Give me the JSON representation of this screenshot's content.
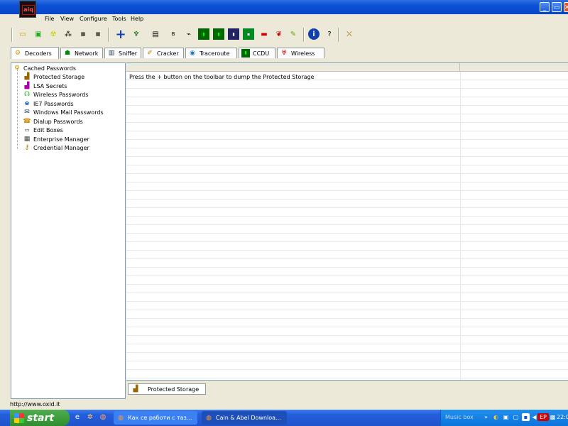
{
  "window": {
    "app_icon_text": "aiq",
    "controls": {
      "minimize": "_",
      "maximize": "▭",
      "close": "✕"
    }
  },
  "menu": [
    "File",
    "View",
    "Configure",
    "Tools",
    "Help"
  ],
  "toolbar_icons": [
    "folder-open-icon",
    "sniffer-start-icon",
    "radioactive-icon",
    "arp-icon",
    "hash-icon",
    "hash-icon-2",
    "add-icon",
    "decoder-icon",
    "dll-icon",
    "b64-icon",
    "route-icon",
    "rsa-icon",
    "lsa-icon",
    "wifi-icon",
    "computer-icon",
    "cisco-icon",
    "hash-calc-icon",
    "vnc-icon",
    "info-icon",
    "help-icon",
    "exit-icon"
  ],
  "tabs": [
    {
      "label": "Decoders",
      "icon": "decoders-icon",
      "active": true
    },
    {
      "label": "Network",
      "icon": "network-icon"
    },
    {
      "label": "Sniffer",
      "icon": "sniffer-icon"
    },
    {
      "label": "Cracker",
      "icon": "cracker-icon"
    },
    {
      "label": "Traceroute",
      "icon": "traceroute-icon"
    },
    {
      "label": "CCDU",
      "icon": "ccdu-icon"
    },
    {
      "label": "Wireless",
      "icon": "wireless-icon"
    }
  ],
  "tree": {
    "root": "Cached Passwords",
    "items": [
      "Protected Storage",
      "LSA Secrets",
      "Wireless Passwords",
      "IE7 Passwords",
      "Windows Mail Passwords",
      "Dialup Passwords",
      "Edit Boxes",
      "Enterprise Manager",
      "Credential Manager"
    ]
  },
  "list": {
    "message": "Press the + button on the toolbar to dump the Protected Storage"
  },
  "bottom_tab": {
    "label": "Protected Storage"
  },
  "statusbar": {
    "url": "http://www.oxid.it"
  },
  "taskbar": {
    "start_label": "start",
    "tasks": [
      {
        "label": "Как се работи с таз...",
        "active": false
      },
      {
        "label": "Cain & Abel Downloa...",
        "active": true
      }
    ],
    "tray_label": "Music box",
    "tray_lang": "EP",
    "clock": "22:0"
  }
}
